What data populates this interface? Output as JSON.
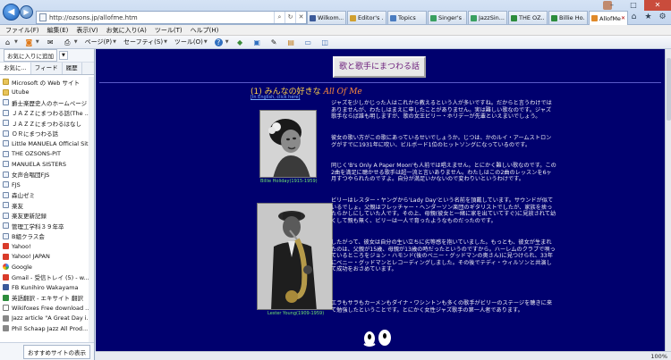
{
  "browser": {
    "url": "http://ozsons.jp/allofme.htm",
    "tabs": [
      {
        "label": "Wilkom...",
        "color": "#3b5a9a",
        "active": false
      },
      {
        "label": "Editor's ...",
        "color": "#d0a030",
        "active": false
      },
      {
        "label": "Topics",
        "color": "#4a7cc0",
        "active": false
      },
      {
        "label": "Singer's ...",
        "color": "#3aa060",
        "active": false
      },
      {
        "label": "JazzSin...",
        "color": "#3aa060",
        "active": false
      },
      {
        "label": "THE OZ...",
        "color": "#2c8c3c",
        "active": false
      },
      {
        "label": "Billie Ho...",
        "color": "#2c8c3c",
        "active": false
      },
      {
        "label": "AllofMe",
        "color": "#e08a2a",
        "active": true
      }
    ]
  },
  "menubar": [
    "ファイル(F)",
    "編集(E)",
    "表示(V)",
    "お気に入り(A)",
    "ツール(T)",
    "ヘルプ(H)"
  ],
  "commandbar": {
    "page": "ページ(P)",
    "safety": "セーフティ(S)",
    "tools": "ツール(O)"
  },
  "sidebar": {
    "add_button": "お気に入りに追加",
    "tabs": [
      "お気に...",
      "フィード",
      "履歴"
    ],
    "items": [
      {
        "label": "Microsoft の Web サイト",
        "icon": "folder"
      },
      {
        "label": "Utube",
        "icon": "folder"
      },
      {
        "label": "爵士楽歴史人のホームページ",
        "icon": "page"
      },
      {
        "label": "ＪＡＺＺにまつわる話(The ...",
        "icon": "page"
      },
      {
        "label": "ＪＡＺＺにまつわるはなし",
        "icon": "page"
      },
      {
        "label": "ＯＲにまつわる話",
        "icon": "page"
      },
      {
        "label": "Little MANUELA Official Site",
        "icon": "page"
      },
      {
        "label": "THE OZSONS-PIT",
        "icon": "page"
      },
      {
        "label": "MANUELA SISTERS",
        "icon": "page"
      },
      {
        "label": "女声合唱団FJS",
        "icon": "page"
      },
      {
        "label": "FJS",
        "icon": "page"
      },
      {
        "label": "森山ゼミ",
        "icon": "page"
      },
      {
        "label": "楽友",
        "icon": "page"
      },
      {
        "label": "楽友更新記録",
        "icon": "page"
      },
      {
        "label": "管理工学科３９年卒",
        "icon": "page"
      },
      {
        "label": "B組クラス会",
        "icon": "page"
      },
      {
        "label": "Yahoo!",
        "icon": "red"
      },
      {
        "label": "Yahoo! JAPAN",
        "icon": "red"
      },
      {
        "label": "Google",
        "icon": "g"
      },
      {
        "label": "Gmail - 受信トレイ (5) - w...",
        "icon": "red"
      },
      {
        "label": "FB Kunihiro Wakayama",
        "icon": "blue"
      },
      {
        "label": "英語翻訳 - エキサイト 翻訳",
        "icon": "green"
      },
      {
        "label": "Wikifoxes  Free download ...",
        "icon": "wiki"
      },
      {
        "label": "Jazz article \"A Great Day i...",
        "icon": "gray"
      },
      {
        "label": "Phil Schaap Jazz  All Prod...",
        "icon": "gray"
      }
    ],
    "footer_button": "おすすめサイトの表示"
  },
  "page": {
    "title_button": "歌と歌手にまつわる話",
    "heading_prefix": "(1) みんなの好きな",
    "heading_song": "All Of Me",
    "english_link": "[In English, click here]",
    "caption1": "Billie Holiday(1915-1959)",
    "caption2": "Lester Young(1909-1959)",
    "paragraphs": [
      "ジャズを少しかじった人はこれから教えるという人が多いですね。だからと言うわけではありませんが、わたしはまえに申したことがありません。実は難しい歌なのです。ジャズ歌手ならば誰も明しますが、歌の女王ビリー・ホリデーが先輩といえまいでしょう。",
      "彼女の歌い方がこの歌にあっているせいでしょうか。じつは、かのルイ・アームストロングがすでに1931年に吹い、ビルボード1位のヒットソングになっているのです。",
      "同じく'B's Only A Paper Moon'も人前では唱えません。とにかく難しい歌なのです。この2曲を満足に聴かせる歌手は超一流と言いありません。わたしはこの2曲のレッスンを6ヶ月すつやられたのですよ。自分が満足いかないので変わりいというわけです。",
      "ビリーはレスター・ヤングから'Lady Day'という名前を頂戴しています。サウンドが似ているでしょ。父親はフレッチャー・ヘンダーソン楽団のギタリストでしたが、家族を捨ったらかしにしていた人です。その上、母親(彼女と一緒に家を出ていてすぐ)に見放されて幼くして親も無く、ビリーは一人で育ったようなものだったのです。",
      "したがって、彼女は自分の生い立ちに劣等感を抱いていました。もっとも、彼女が生まれたのは、父親が15歳、母親が13歳の時だったというのですから。ハーレムのクラブで唄っているところをジョン・ハモンド(後のベニー・グッドマンの奥さん)に見つけられ、33年にベニー・グッドマンとレコーディングしました。その後でテディ・ウィルソンと共演して成功をおさめています。",
      "エラもサラもカーメンもダイナ・ワシントンも多くの歌手がビリーのステージを聴きに来て勉強したということです。とにかく女性ジャズ歌手の第一人者であります。"
    ]
  },
  "status": {
    "zoom": "100%"
  }
}
